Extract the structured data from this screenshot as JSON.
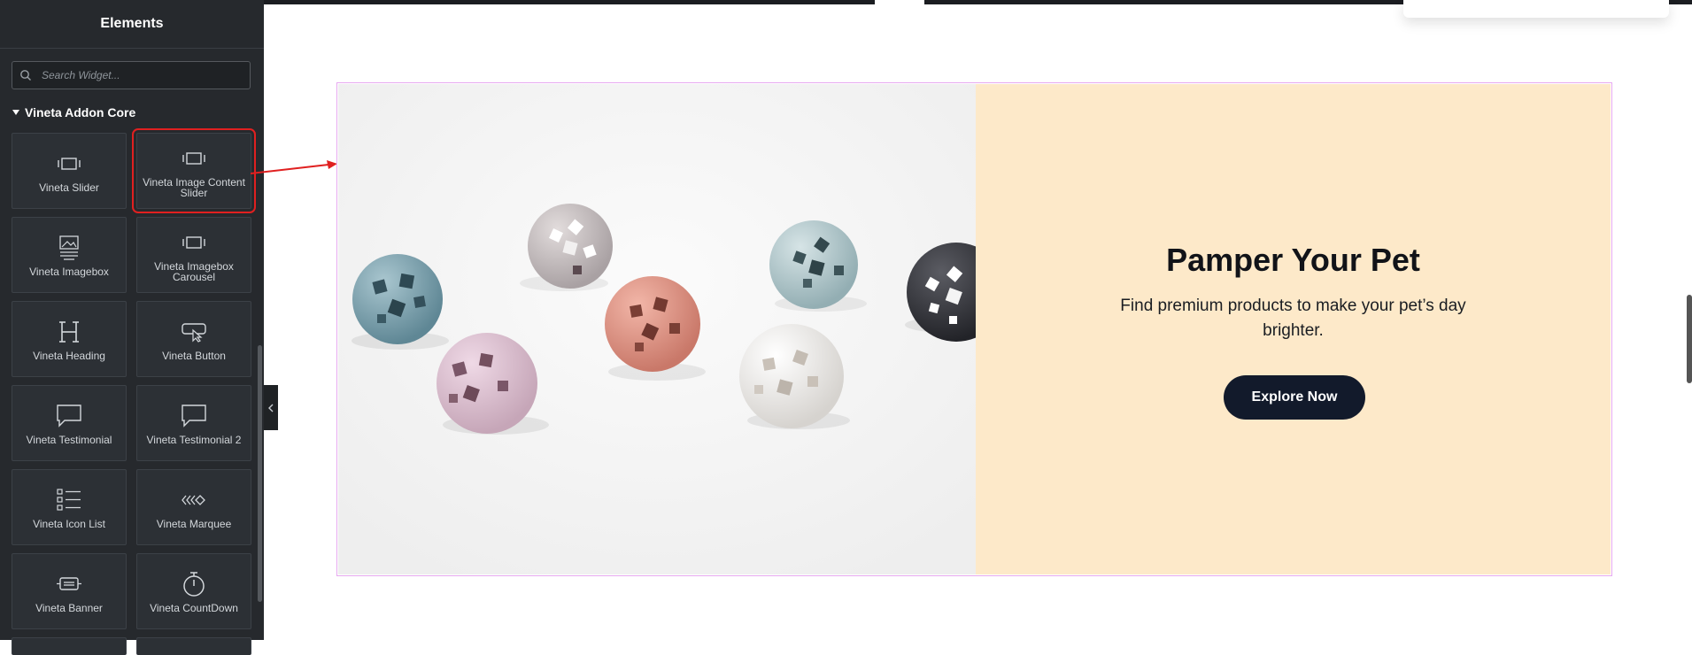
{
  "panel": {
    "title": "Elements",
    "search_placeholder": "Search Widget...",
    "category": "Vineta Addon Core",
    "widgets": [
      {
        "label": "Vineta Slider",
        "icon": "slider-icon"
      },
      {
        "label": "Vineta Image Content Slider",
        "icon": "slider-icon",
        "highlighted": true
      },
      {
        "label": "Vineta Imagebox",
        "icon": "image-box-icon"
      },
      {
        "label": "Vineta Imagebox Carousel",
        "icon": "slider-icon"
      },
      {
        "label": "Vineta Heading",
        "icon": "heading-icon"
      },
      {
        "label": "Vineta Button",
        "icon": "button-icon"
      },
      {
        "label": "Vineta Testimonial",
        "icon": "speech-bubble-icon"
      },
      {
        "label": "Vineta Testimonial 2",
        "icon": "speech-bubble-icon"
      },
      {
        "label": "Vineta Icon List",
        "icon": "icon-list-icon"
      },
      {
        "label": "Vineta Marquee",
        "icon": "marquee-icon"
      },
      {
        "label": "Vineta Banner",
        "icon": "banner-icon"
      },
      {
        "label": "Vineta CountDown",
        "icon": "countdown-icon"
      }
    ]
  },
  "canvas": {
    "heading": "Pamper Your Pet",
    "description": "Find premium products to make your pet’s day brighter.",
    "button_label": "Explore Now"
  },
  "colors": {
    "panel_bg": "#26292d",
    "content_bg": "#fde9c9",
    "button_bg": "#121a2b",
    "highlight": "#e02020",
    "section_border": "#e7a9f0"
  }
}
